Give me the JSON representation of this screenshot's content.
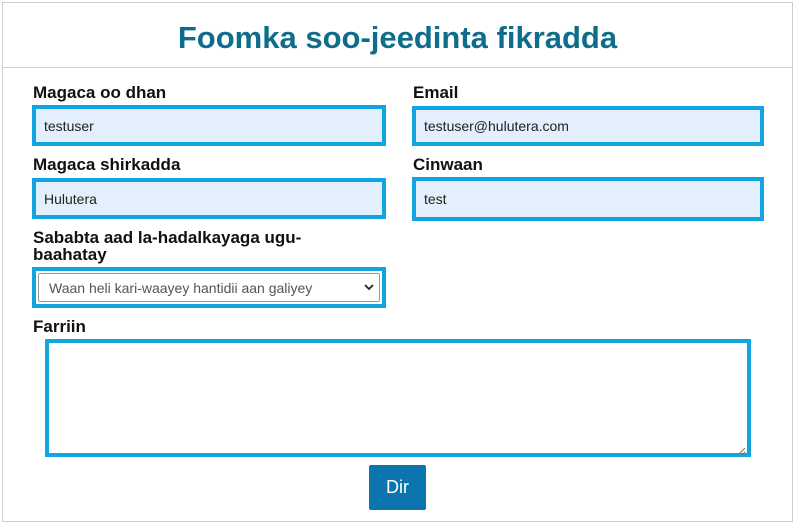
{
  "form": {
    "title": "Foomka soo-jeedinta fikradda",
    "fields": {
      "name": {
        "label": "Magaca oo dhan",
        "value": "testuser"
      },
      "email": {
        "label": "Email",
        "value": "testuser@hulutera.com"
      },
      "company": {
        "label": "Magaca shirkadda",
        "value": "Hulutera"
      },
      "address": {
        "label": "Cinwaan",
        "value": "test"
      },
      "reason": {
        "label_line1": "Sababta aad la-hadalkayaga ugu-",
        "label_line2": "baahatay",
        "selected": "Waan heli kari-waayey hantidii aan galiyey"
      },
      "message": {
        "label": "Farriin",
        "value": ""
      }
    },
    "submit_label": "Dir"
  },
  "colors": {
    "title": "#0e6d8a",
    "field_border": "#10a4e0",
    "field_fill": "#e3effc",
    "button": "#0c75ad"
  },
  "icons": {
    "select_arrow": "chevron-down-icon",
    "textarea_grip": "resize-grip-icon"
  }
}
